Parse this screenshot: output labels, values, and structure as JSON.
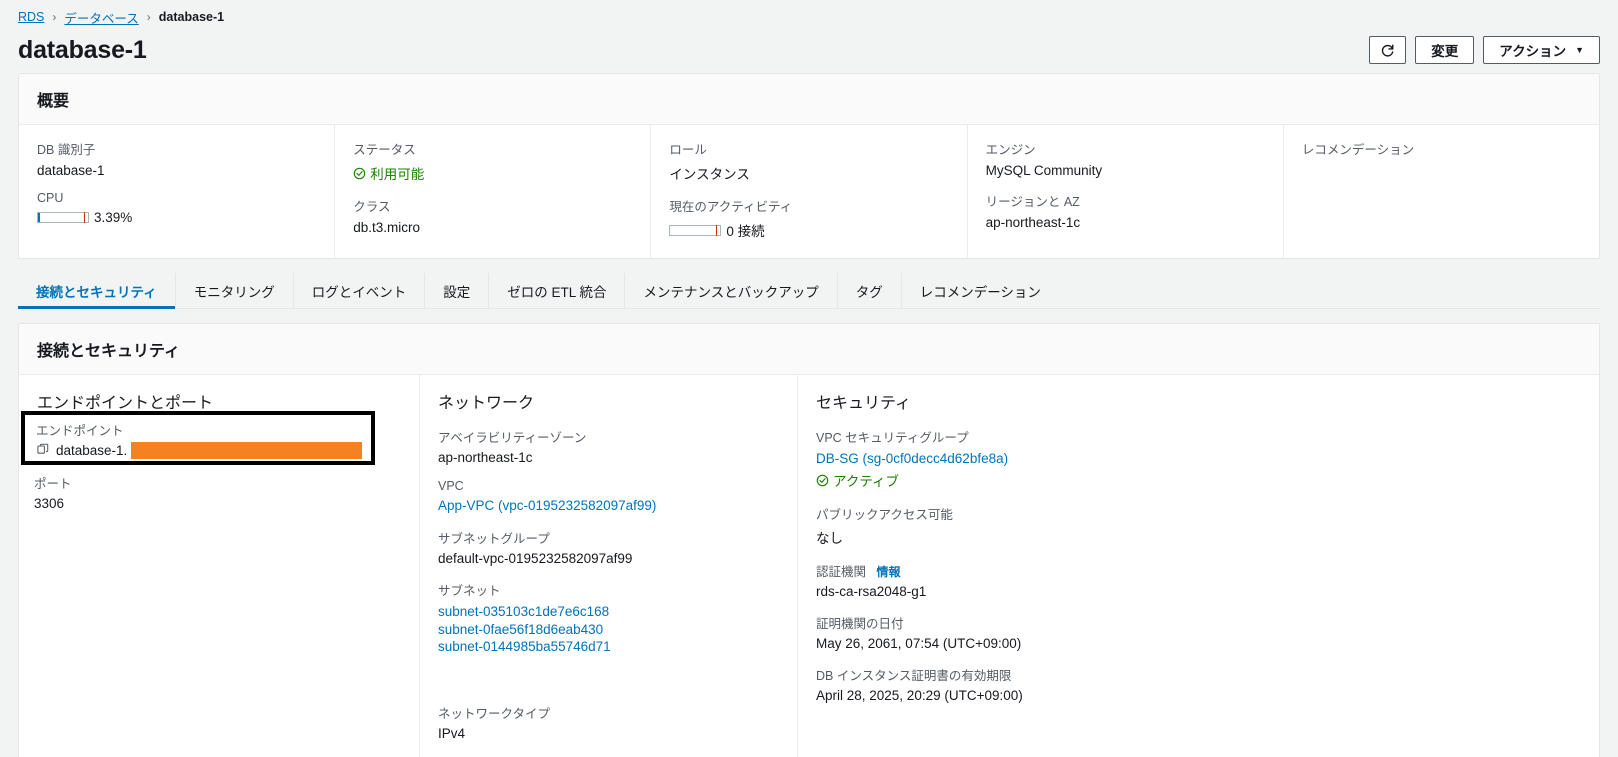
{
  "breadcrumb": {
    "items": [
      {
        "label": "RDS",
        "link": true
      },
      {
        "label": "データベース",
        "link": true
      },
      {
        "label": "database-1",
        "link": false
      }
    ],
    "separator": "›"
  },
  "header": {
    "title": "database-1",
    "refresh_icon": "refresh-icon",
    "modify_label": "変更",
    "actions_label": "アクション",
    "actions_caret": "▼"
  },
  "overview": {
    "title": "概要",
    "columns": [
      {
        "fields": [
          {
            "label": "DB 識別子",
            "value": "database-1",
            "type": "text"
          },
          {
            "label": "CPU",
            "value": "3.39%",
            "type": "gauge",
            "percent": 3.39,
            "mark_percent": 92
          }
        ]
      },
      {
        "fields": [
          {
            "label": "ステータス",
            "value": "利用可能",
            "type": "status",
            "status_color": "#1d8102"
          },
          {
            "label": "クラス",
            "value": "db.t3.micro",
            "type": "text"
          }
        ]
      },
      {
        "fields": [
          {
            "label": "ロール",
            "value": "インスタンス",
            "type": "text"
          },
          {
            "label": "現在のアクティビティ",
            "value": "0 接続",
            "type": "gauge",
            "percent": 0,
            "mark_percent": 92
          }
        ]
      },
      {
        "fields": [
          {
            "label": "エンジン",
            "value": "MySQL Community",
            "type": "text"
          },
          {
            "label": "リージョンと AZ",
            "value": "ap-northeast-1c",
            "type": "text"
          }
        ]
      },
      {
        "fields": [
          {
            "label": "レコメンデーション",
            "value": "",
            "type": "text"
          }
        ]
      }
    ]
  },
  "tabs": [
    {
      "label": "接続とセキュリティ",
      "active": true
    },
    {
      "label": "モニタリング",
      "active": false
    },
    {
      "label": "ログとイベント",
      "active": false
    },
    {
      "label": "設定",
      "active": false
    },
    {
      "label": "ゼロの ETL 統合",
      "active": false
    },
    {
      "label": "メンテナンスとバックアップ",
      "active": false
    },
    {
      "label": "タグ",
      "active": false
    },
    {
      "label": "レコメンデーション",
      "active": false
    }
  ],
  "connectivity": {
    "title": "接続とセキュリティ",
    "endpoint_section": {
      "heading": "エンドポイントとポート",
      "endpoint_label": "エンドポイント",
      "endpoint_value": "database-1.",
      "endpoint_redacted": true,
      "copy_icon": "copy-icon",
      "port_label": "ポート",
      "port_value": "3306",
      "highlight_color": "#000000",
      "redaction_color": "#f58220"
    },
    "network_section": {
      "heading": "ネットワーク",
      "fields": [
        {
          "label": "アベイラビリティーゾーン",
          "values": [
            "ap-northeast-1c"
          ],
          "link": false
        },
        {
          "label": "VPC",
          "values": [
            "App-VPC (vpc-0195232582097af99)"
          ],
          "link": true
        },
        {
          "label": "サブネットグループ",
          "values": [
            "default-vpc-0195232582097af99"
          ],
          "link": false
        },
        {
          "label": "サブネット",
          "values": [
            "subnet-035103c1de7e6c168",
            "subnet-0fae56f18d6eab430",
            "subnet-0144985ba55746d71"
          ],
          "link": true
        },
        {
          "label": "ネットワークタイプ",
          "values": [
            "IPv4"
          ],
          "link": false
        }
      ]
    },
    "security_section": {
      "heading": "セキュリティ",
      "vpc_sg_label": "VPC セキュリティグループ",
      "vpc_sg_value": "DB-SG (sg-0cf0decc4d62bfe8a)",
      "vpc_sg_status": "アクティブ",
      "public_access_label": "パブリックアクセス可能",
      "public_access_value": "なし",
      "ca_label": "認証機関",
      "ca_info_label": "情報",
      "ca_value": "rds-ca-rsa2048-g1",
      "ca_date_label": "証明機関の日付",
      "ca_date_value": "May 26, 2061, 07:54 (UTC+09:00)",
      "cert_expiry_label": "DB インスタンス証明書の有効期限",
      "cert_expiry_value": "April 28, 2025, 20:29 (UTC+09:00)"
    }
  }
}
